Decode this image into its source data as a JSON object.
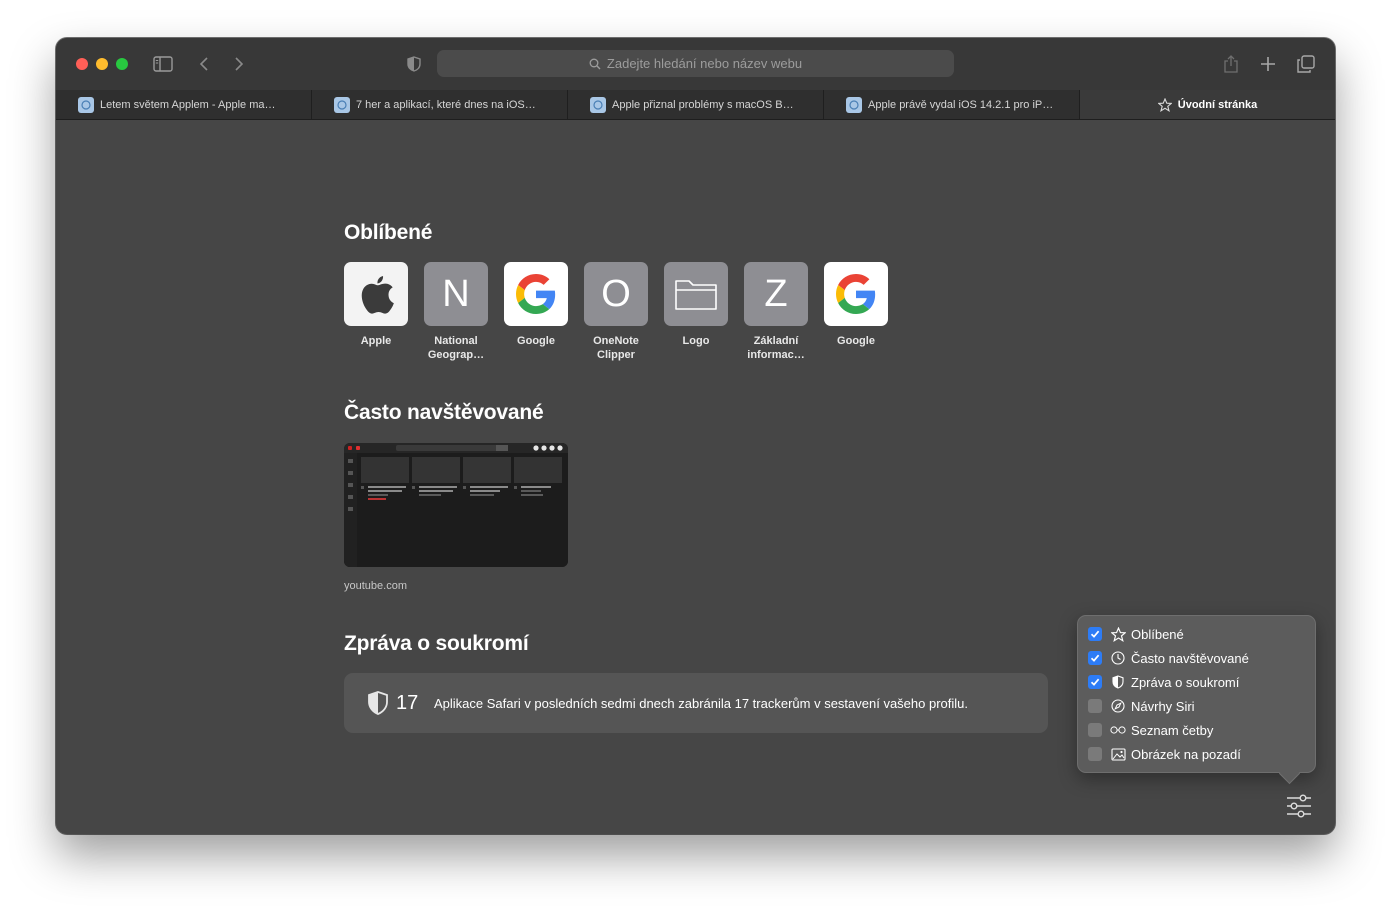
{
  "address_bar": {
    "placeholder": "Zadejte hledání nebo název webu"
  },
  "tabs": [
    {
      "title": "Letem světem Applem - Apple ma…",
      "active": false
    },
    {
      "title": "7 her a aplikací, které dnes na iOS…",
      "active": false
    },
    {
      "title": "Apple přiznal problémy s macOS B…",
      "active": false
    },
    {
      "title": "Apple právě vydal iOS 14.2.1 pro iP…",
      "active": false
    },
    {
      "title": "Úvodní stránka",
      "active": true
    }
  ],
  "favorites": {
    "title": "Oblíbené",
    "items": [
      {
        "label": "Apple",
        "icon": "apple-icon"
      },
      {
        "label": "National Geograp…",
        "letter": "N"
      },
      {
        "label": "Google",
        "icon": "google-icon"
      },
      {
        "label": "OneNote Clipper",
        "letter": "O"
      },
      {
        "label": "Logo",
        "icon": "folder-icon"
      },
      {
        "label": "Základní informac…",
        "letter": "Z"
      },
      {
        "label": "Google",
        "icon": "google-icon"
      }
    ]
  },
  "frequent": {
    "title": "Často navštěvované",
    "items": [
      {
        "label": "youtube.com"
      }
    ]
  },
  "privacy": {
    "title": "Zpráva o soukromí",
    "count": "17",
    "message": "Aplikace Safari v posledních sedmi dnech zabránila 17 trackerům v sestavení vašeho profilu."
  },
  "customize_menu": {
    "items": [
      {
        "label": "Oblíbené",
        "checked": true,
        "icon": "star-icon"
      },
      {
        "label": "Často navštěvované",
        "checked": true,
        "icon": "clock-icon"
      },
      {
        "label": "Zpráva o soukromí",
        "checked": true,
        "icon": "shield-icon"
      },
      {
        "label": "Návrhy Siri",
        "checked": false,
        "icon": "compass-icon"
      },
      {
        "label": "Seznam četby",
        "checked": false,
        "icon": "glasses-icon"
      },
      {
        "label": "Obrázek na pozadí",
        "checked": false,
        "icon": "image-icon"
      }
    ]
  },
  "colors": {
    "close": "#fe5f57",
    "minimize": "#febc2e",
    "zoom": "#28c840",
    "checkbox_accent": "#2d7cf6",
    "window_bg": "#464646"
  }
}
